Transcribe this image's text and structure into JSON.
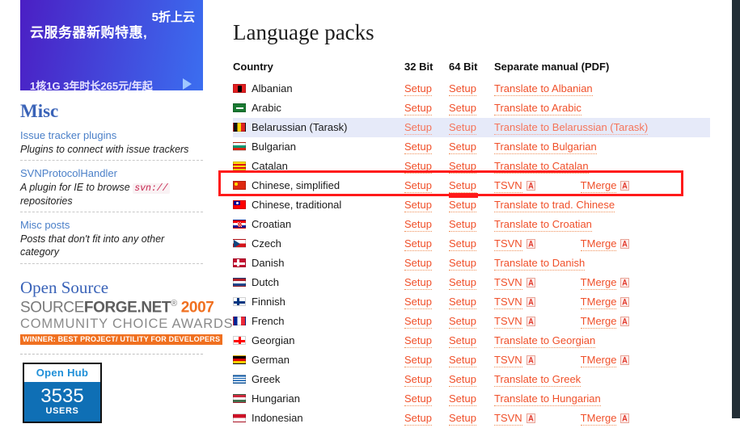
{
  "right_band_color": "#232f36",
  "ad": {
    "main_text": "云服务器新购特惠,",
    "badge_text": "5折上云",
    "sub_text": "1核1G 3年时长265元/年起",
    "gradient_from": "#4b1fc4",
    "gradient_to": "#3b6ef0"
  },
  "sidebar": {
    "misc": {
      "heading": "Misc",
      "entries": [
        {
          "title": "Issue tracker plugins",
          "desc": "Plugins to connect with issue trackers",
          "chip": ""
        },
        {
          "title": "SVNProtocolHandler",
          "desc_before": "A plugin for IE to browse",
          "chip": "svn://",
          "desc_after": "repositories"
        },
        {
          "title": "Misc posts",
          "desc": "Posts that don't fit into any other category",
          "chip": ""
        }
      ]
    },
    "opensource": {
      "heading": "Open Source",
      "sf_line1_a": "SOURCE",
      "sf_line1_b": "FORGE",
      "sf_line1_c": ".NET",
      "sf_reg": "®",
      "sf_year": "2007",
      "sf_line2": "COMMUNITY  CHOICE  AWARDS",
      "sf_winner": "WINNER: BEST PROJECT/ UTILITY FOR DEVELOPERS"
    },
    "openhub": {
      "title": "Open Hub",
      "count": "3535",
      "label": "USERS",
      "body_color": "#0f6fb5",
      "title_color": "#1f8fd8"
    }
  },
  "main": {
    "title": "Language packs",
    "table": {
      "headers": {
        "country": "Country",
        "bit32": "32 Bit",
        "bit64": "64 Bit",
        "manual": "Separate manual (PDF)"
      },
      "setup_label": "Setup",
      "tsvn_label": "TSVN",
      "tmerge_label": "TMerge",
      "rows": [
        {
          "country": "Albanian",
          "manual_type": "translate",
          "manual": "Translate to Albanian",
          "flag": "albania",
          "highlight": false
        },
        {
          "country": "Arabic",
          "manual_type": "translate",
          "manual": "Translate to Arabic",
          "flag": "arabic",
          "highlight": false
        },
        {
          "country": "Belarussian (Tarask)",
          "manual_type": "translate",
          "manual": "Translate to Belarussian (Tarask)",
          "flag": "belarus",
          "highlight": true
        },
        {
          "country": "Bulgarian",
          "manual_type": "translate",
          "manual": "Translate to Bulgarian",
          "flag": "bulgaria",
          "highlight": false
        },
        {
          "country": "Catalan",
          "manual_type": "translate",
          "manual": "Translate to Catalan",
          "flag": "catalan",
          "highlight": false
        },
        {
          "country": "Chinese, simplified",
          "manual_type": "pdf",
          "manual": "",
          "flag": "china",
          "highlight": false
        },
        {
          "country": "Chinese, traditional",
          "manual_type": "translate",
          "manual": "Translate to trad. Chinese",
          "flag": "taiwan",
          "highlight": false
        },
        {
          "country": "Croatian",
          "manual_type": "translate",
          "manual": "Translate to Croatian",
          "flag": "croatia",
          "highlight": false
        },
        {
          "country": "Czech",
          "manual_type": "pdf",
          "manual": "",
          "flag": "czech",
          "highlight": false
        },
        {
          "country": "Danish",
          "manual_type": "translate",
          "manual": "Translate to Danish",
          "flag": "denmark",
          "highlight": false
        },
        {
          "country": "Dutch",
          "manual_type": "pdf",
          "manual": "",
          "flag": "netherlands",
          "highlight": false
        },
        {
          "country": "Finnish",
          "manual_type": "pdf",
          "manual": "",
          "flag": "finland",
          "highlight": false
        },
        {
          "country": "French",
          "manual_type": "pdf",
          "manual": "",
          "flag": "france",
          "highlight": false
        },
        {
          "country": "Georgian",
          "manual_type": "translate",
          "manual": "Translate to Georgian",
          "flag": "georgia",
          "highlight": false
        },
        {
          "country": "German",
          "manual_type": "pdf",
          "manual": "",
          "flag": "germany",
          "highlight": false
        },
        {
          "country": "Greek",
          "manual_type": "translate",
          "manual": "Translate to Greek",
          "flag": "greece",
          "highlight": false
        },
        {
          "country": "Hungarian",
          "manual_type": "translate",
          "manual": "Translate to Hungarian",
          "flag": "hungary",
          "highlight": false
        },
        {
          "country": "Indonesian",
          "manual_type": "pdf",
          "manual": "",
          "flag": "indonesia",
          "highlight": false
        }
      ]
    }
  },
  "annotation": {
    "box_color": "#ff1a1a",
    "target_row": "Chinese, simplified",
    "marker_target": "64 Bit Setup"
  }
}
